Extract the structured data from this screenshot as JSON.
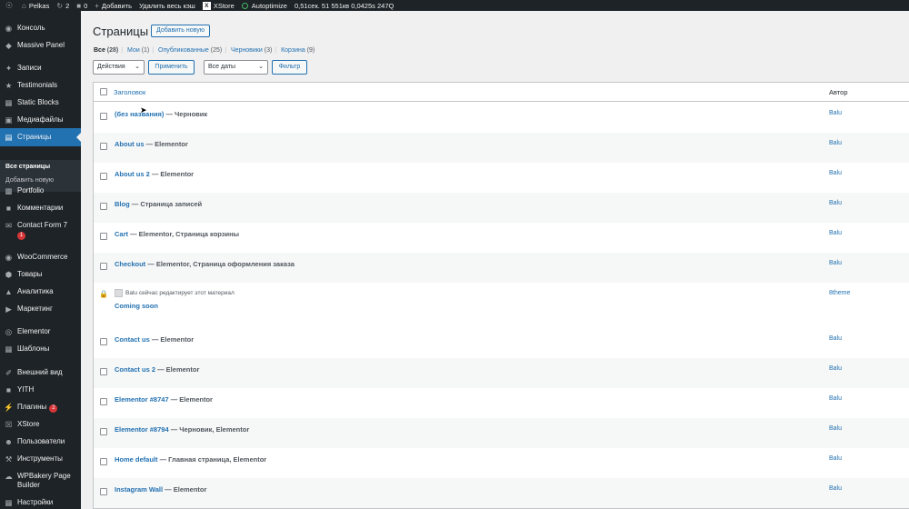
{
  "adminbar": {
    "site": "Pelkas",
    "updates": "2",
    "comments": "0",
    "new": "Добавить",
    "clear_cache": "Удалить весь кэш",
    "xstore": "XStore",
    "autoptimize": "Autoptimize",
    "perf": "0,51сек.  51 551кв  0,0425s  247Q"
  },
  "sidebar": {
    "items": [
      {
        "label": "Консоль",
        "icon": "dashboard-icon"
      },
      {
        "label": "Massive Panel",
        "icon": "massive-panel-icon"
      },
      {
        "label": "Записи",
        "icon": "pin-icon"
      },
      {
        "label": "Testimonials",
        "icon": "testimonials-icon"
      },
      {
        "label": "Static Blocks",
        "icon": "static-blocks-icon"
      },
      {
        "label": "Медиафайлы",
        "icon": "media-icon"
      },
      {
        "label": "Страницы",
        "icon": "pages-icon"
      },
      {
        "label": "Portfolio",
        "icon": "portfolio-icon"
      },
      {
        "label": "Комментарии",
        "icon": "comments-icon"
      },
      {
        "label": "Contact Form 7",
        "icon": "mail-icon",
        "badge": "1"
      },
      {
        "label": "WooCommerce",
        "icon": "woocommerce-icon"
      },
      {
        "label": "Товары",
        "icon": "products-icon"
      },
      {
        "label": "Аналитика",
        "icon": "analytics-icon"
      },
      {
        "label": "Маркетинг",
        "icon": "marketing-icon"
      },
      {
        "label": "Elementor",
        "icon": "elementor-icon"
      },
      {
        "label": "Шаблоны",
        "icon": "templates-icon"
      },
      {
        "label": "Внешний вид",
        "icon": "appearance-icon"
      },
      {
        "label": "YITH",
        "icon": "yith-icon"
      },
      {
        "label": "Плагины",
        "icon": "plugins-icon",
        "badge": "2"
      },
      {
        "label": "XStore",
        "icon": "xstore-icon"
      },
      {
        "label": "Пользователи",
        "icon": "users-icon"
      },
      {
        "label": "Инструменты",
        "icon": "tools-icon"
      },
      {
        "label": "WPBakery Page Builder",
        "icon": "wpbakery-icon"
      },
      {
        "label": "Настройки",
        "icon": "settings-icon"
      }
    ],
    "submenu": [
      "Все страницы",
      "Добавить новую"
    ]
  },
  "main": {
    "title": "Страницы",
    "add_new": "Добавить новую",
    "views": [
      {
        "label": "Все",
        "count": "(28)"
      },
      {
        "label": "Мои",
        "count": "(1)"
      },
      {
        "label": "Опубликованные",
        "count": "(25)"
      },
      {
        "label": "Черновики",
        "count": "(3)"
      },
      {
        "label": "Корзина",
        "count": "(9)"
      }
    ],
    "bulk_action": "Действия",
    "apply": "Применить",
    "dates": "Все даты",
    "filter": "Фильтр",
    "col_title": "Заголовок",
    "col_author": "Автор",
    "rows": [
      {
        "title": "(без названия)",
        "state": " — Черновик",
        "author": "Balu"
      },
      {
        "title": "About us",
        "state": " — Elementor",
        "author": "Balu"
      },
      {
        "title": "About us 2",
        "state": " — Elementor",
        "author": "Balu"
      },
      {
        "title": "Blog",
        "state": " — Страница записей",
        "author": "Balu"
      },
      {
        "title": "Cart",
        "state": " — Elementor, Страница корзины",
        "author": "Balu"
      },
      {
        "title": "Checkout",
        "state": " — Elementor, Страница оформления заказа",
        "author": "Balu"
      },
      {
        "title": "Contact us",
        "state": " — Elementor",
        "author": "Balu"
      },
      {
        "title": "Contact us 2",
        "state": " — Elementor",
        "author": "Balu"
      },
      {
        "title": "Elementor #8747",
        "state": " — Elementor",
        "author": "Balu"
      },
      {
        "title": "Elementor #8794",
        "state": " — Черновик, Elementor",
        "author": "Balu"
      },
      {
        "title": "Home default",
        "state": " — Главная страница, Elementor",
        "author": "Balu"
      },
      {
        "title": "Instagram Wall",
        "state": " — Elementor",
        "author": "Balu"
      }
    ],
    "locked_row": {
      "notice": "Balu сейчас редактирует этот материал",
      "title": "Coming soon",
      "author": "8theme"
    }
  }
}
